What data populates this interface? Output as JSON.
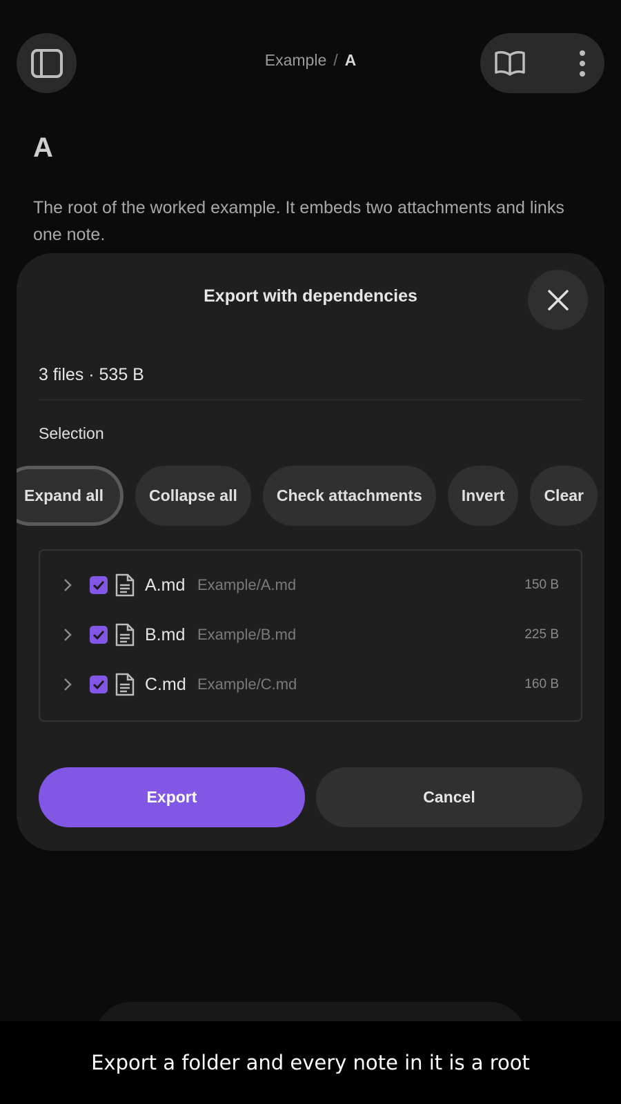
{
  "breadcrumb": {
    "parent": "Example",
    "separator": "/",
    "current": "A"
  },
  "note": {
    "title": "A",
    "body": "The root of the worked example. It embeds two attachments and links one note."
  },
  "dialog": {
    "title": "Export with dependencies",
    "summary": "3 files · 535 B",
    "section_label": "Selection",
    "chips": [
      "Expand all",
      "Collapse all",
      "Check attachments",
      "Invert",
      "Clear"
    ],
    "files": [
      {
        "name": "A.md",
        "path": "Example/A.md",
        "size": "150 B",
        "checked": true
      },
      {
        "name": "B.md",
        "path": "Example/B.md",
        "size": "225 B",
        "checked": true
      },
      {
        "name": "C.md",
        "path": "Example/C.md",
        "size": "160 B",
        "checked": true
      }
    ],
    "export_label": "Export",
    "cancel_label": "Cancel"
  },
  "caption": "Export a folder and every note in it is a root",
  "colors": {
    "accent": "#8257e6",
    "background": "#0b0b0b",
    "dialog": "#1f1f1f"
  }
}
